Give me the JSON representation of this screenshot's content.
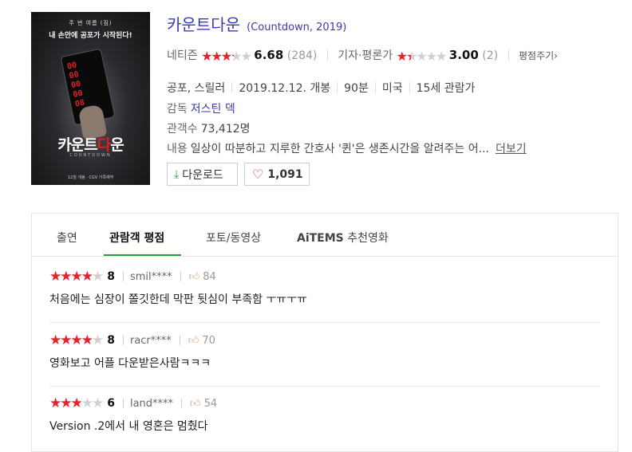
{
  "poster": {
    "tagline_top": "주 번 여름 (짐)",
    "tagline_main": "내 손안에 공포가 시작된다!",
    "title_pre": "카운트",
    "title_red": "다",
    "title_post": "운",
    "subtitle": "COUNTDOWN",
    "release_note": "12월 개봉 · CGV 가족예약",
    "digits": [
      "00",
      "00",
      "00",
      "00",
      "08"
    ]
  },
  "movie": {
    "title": "카운트다운",
    "original": "(Countdown, 2019)"
  },
  "ratings": {
    "netizen_label": "네티즌",
    "netizen_score": "6.68",
    "netizen_count": "(284)",
    "netizen_fraction": 0.668,
    "critic_label": "기자·평론가",
    "critic_score": "3.00",
    "critic_count": "(2)",
    "critic_fraction": 0.3,
    "rate_link": "평점주기"
  },
  "info": {
    "genre": "공포, 스릴러",
    "release": "2019.12.12. 개봉",
    "runtime": "90분",
    "country": "미국",
    "age": "15세 관람가",
    "director_label": "감독",
    "director": "저스틴 덱",
    "audience_label": "관객수",
    "audience": "73,412명",
    "plot_label": "내용",
    "plot": "일상이 따분하고 지루한 간호사 '퀸'은 생존시간을 알려주는 어...",
    "more": "더보기"
  },
  "actions": {
    "download_label": "다운로드",
    "like_count": "1,091"
  },
  "tabs": [
    {
      "label": "출연"
    },
    {
      "label": "관람객 평점"
    },
    {
      "label": "포토/동영상"
    },
    {
      "label_prefix": "AiTEMS",
      "label": "추천영화"
    }
  ],
  "reviews": [
    {
      "score": "8",
      "fraction": 0.8,
      "user": "smil****",
      "likes": "84",
      "text": "처음에는 심장이 쫄깃한데 막판 뒷심이 부족함 ㅜㅠㅜㅠ"
    },
    {
      "score": "8",
      "fraction": 0.8,
      "user": "racr****",
      "likes": "70",
      "text": "영화보고 어플 다운받은사람ㅋㅋㅋ"
    },
    {
      "score": "6",
      "fraction": 0.6,
      "user": "land****",
      "likes": "54",
      "text": "Version .2에서 내 영혼은 멈췄다"
    }
  ],
  "colors": {
    "accent_red": "#e8212d",
    "link_blue": "#3b3bb0",
    "tab_green": "#2a9b3c"
  }
}
